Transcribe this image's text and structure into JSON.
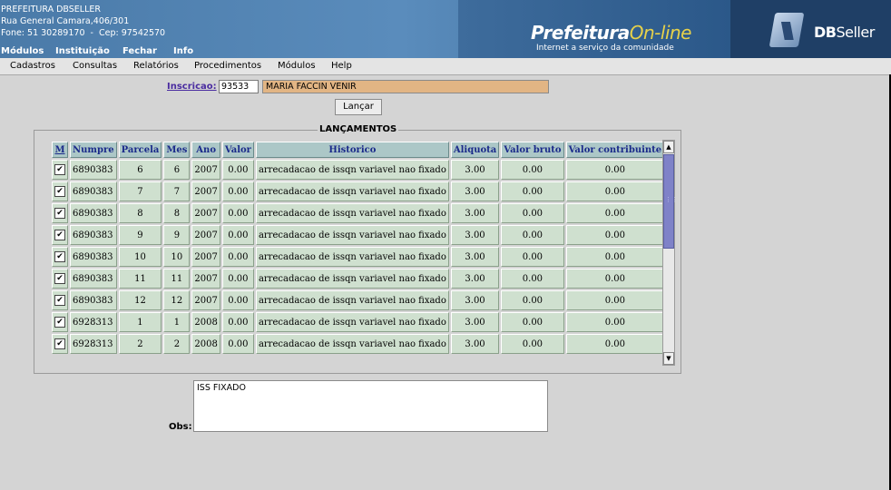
{
  "header": {
    "org_name": "PREFEITURA DBSELLER",
    "address": "Rua General Camara,406/301",
    "phone_line": "Fone: 51 30289170  -  Cep: 97542570",
    "brand_title": "Prefeitura",
    "brand_title_accent": "On-line",
    "brand_subtitle": "Internet a serviço da comunidade",
    "vendor_name": "DB",
    "vendor_name_rest": "Seller"
  },
  "top_menu": [
    "Módulos",
    "Instituição",
    "Fechar",
    "Info"
  ],
  "menu_bar": [
    "Cadastros",
    "Consultas",
    "Relatórios",
    "Procedimentos",
    "Módulos",
    "Help"
  ],
  "form": {
    "inscricao_label": "Inscricao:",
    "inscricao_value": "93533",
    "nome_value": "MARIA FACCIN VENIR",
    "lancar_label": "Lançar",
    "fieldset_legend": "LANÇAMENTOS",
    "obs_label": "Obs:",
    "obs_value": "ISS FIXADO"
  },
  "table": {
    "columns": [
      "M",
      "Numpre",
      "Parcela",
      "Mes",
      "Ano",
      "Valor",
      "Historico",
      "Aliquota",
      "Valor bruto",
      "Valor contribuinte"
    ],
    "rows": [
      {
        "checked": true,
        "numpre": "6890383",
        "parcela": "6",
        "mes": "6",
        "ano": "2007",
        "valor": "0.00",
        "historico": "arrecadacao de issqn variavel nao fixado",
        "aliquota": "3.00",
        "valor_bruto": "0.00",
        "valor_contribuinte": "0.00"
      },
      {
        "checked": true,
        "numpre": "6890383",
        "parcela": "7",
        "mes": "7",
        "ano": "2007",
        "valor": "0.00",
        "historico": "arrecadacao de issqn variavel nao fixado",
        "aliquota": "3.00",
        "valor_bruto": "0.00",
        "valor_contribuinte": "0.00"
      },
      {
        "checked": true,
        "numpre": "6890383",
        "parcela": "8",
        "mes": "8",
        "ano": "2007",
        "valor": "0.00",
        "historico": "arrecadacao de issqn variavel nao fixado",
        "aliquota": "3.00",
        "valor_bruto": "0.00",
        "valor_contribuinte": "0.00"
      },
      {
        "checked": true,
        "numpre": "6890383",
        "parcela": "9",
        "mes": "9",
        "ano": "2007",
        "valor": "0.00",
        "historico": "arrecadacao de issqn variavel nao fixado",
        "aliquota": "3.00",
        "valor_bruto": "0.00",
        "valor_contribuinte": "0.00"
      },
      {
        "checked": true,
        "numpre": "6890383",
        "parcela": "10",
        "mes": "10",
        "ano": "2007",
        "valor": "0.00",
        "historico": "arrecadacao de issqn variavel nao fixado",
        "aliquota": "3.00",
        "valor_bruto": "0.00",
        "valor_contribuinte": "0.00"
      },
      {
        "checked": true,
        "numpre": "6890383",
        "parcela": "11",
        "mes": "11",
        "ano": "2007",
        "valor": "0.00",
        "historico": "arrecadacao de issqn variavel nao fixado",
        "aliquota": "3.00",
        "valor_bruto": "0.00",
        "valor_contribuinte": "0.00"
      },
      {
        "checked": true,
        "numpre": "6890383",
        "parcela": "12",
        "mes": "12",
        "ano": "2007",
        "valor": "0.00",
        "historico": "arrecadacao de issqn variavel nao fixado",
        "aliquota": "3.00",
        "valor_bruto": "0.00",
        "valor_contribuinte": "0.00"
      },
      {
        "checked": true,
        "numpre": "6928313",
        "parcela": "1",
        "mes": "1",
        "ano": "2008",
        "valor": "0.00",
        "historico": "arrecadacao de issqn variavel nao fixado",
        "aliquota": "3.00",
        "valor_bruto": "0.00",
        "valor_contribuinte": "0.00"
      },
      {
        "checked": true,
        "numpre": "6928313",
        "parcela": "2",
        "mes": "2",
        "ano": "2008",
        "valor": "0.00",
        "historico": "arrecadacao de issqn variavel nao fixado",
        "aliquota": "3.00",
        "valor_bruto": "0.00",
        "valor_contribuinte": "0.00"
      }
    ]
  },
  "colors": {
    "header_blue": "#5a8cbc",
    "table_header_bg": "#acc7c7",
    "table_cell_bg": "#cfe0cf",
    "name_field_bg": "#e2b584",
    "scroll_thumb": "#7f82c8"
  }
}
